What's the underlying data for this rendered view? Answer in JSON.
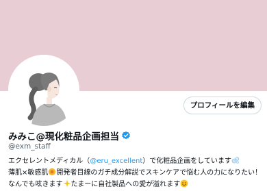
{
  "colors": {
    "banner": "#e8cdd5",
    "accent_blue": "#1d9bf0",
    "text": "#0f1419",
    "subtext": "#536471",
    "border": "#cfd9de"
  },
  "profile": {
    "edit_button_label": "プロフィールを編集",
    "display_name": "みみこ@現化粧品企画担当",
    "handle": "@exm_staff",
    "verified_icon": "verified-badge-icon",
    "avatar_icon": "woman-illustration-avatar"
  },
  "bio": {
    "line1_prefix": "エクセレントメディカル（",
    "line1_mention": "@eru_excellent",
    "line1_suffix": "）で化粧品企画をしています",
    "line1_icon": "soap-bubbles-emoji",
    "line2_prefix": "薄肌×敏感肌",
    "line2_icon": "sunflower-emoji",
    "line2_suffix": "開発者目線のガチ成分解説でスキンケアで悩む人の力になりたい！",
    "line3_prefix": "なんでも呟きます",
    "line3_icon1": "sparkles-emoji",
    "line3_suffix": "たまーに自社製品への愛が溢れます",
    "line3_icon2": "smiling-face-emoji"
  }
}
